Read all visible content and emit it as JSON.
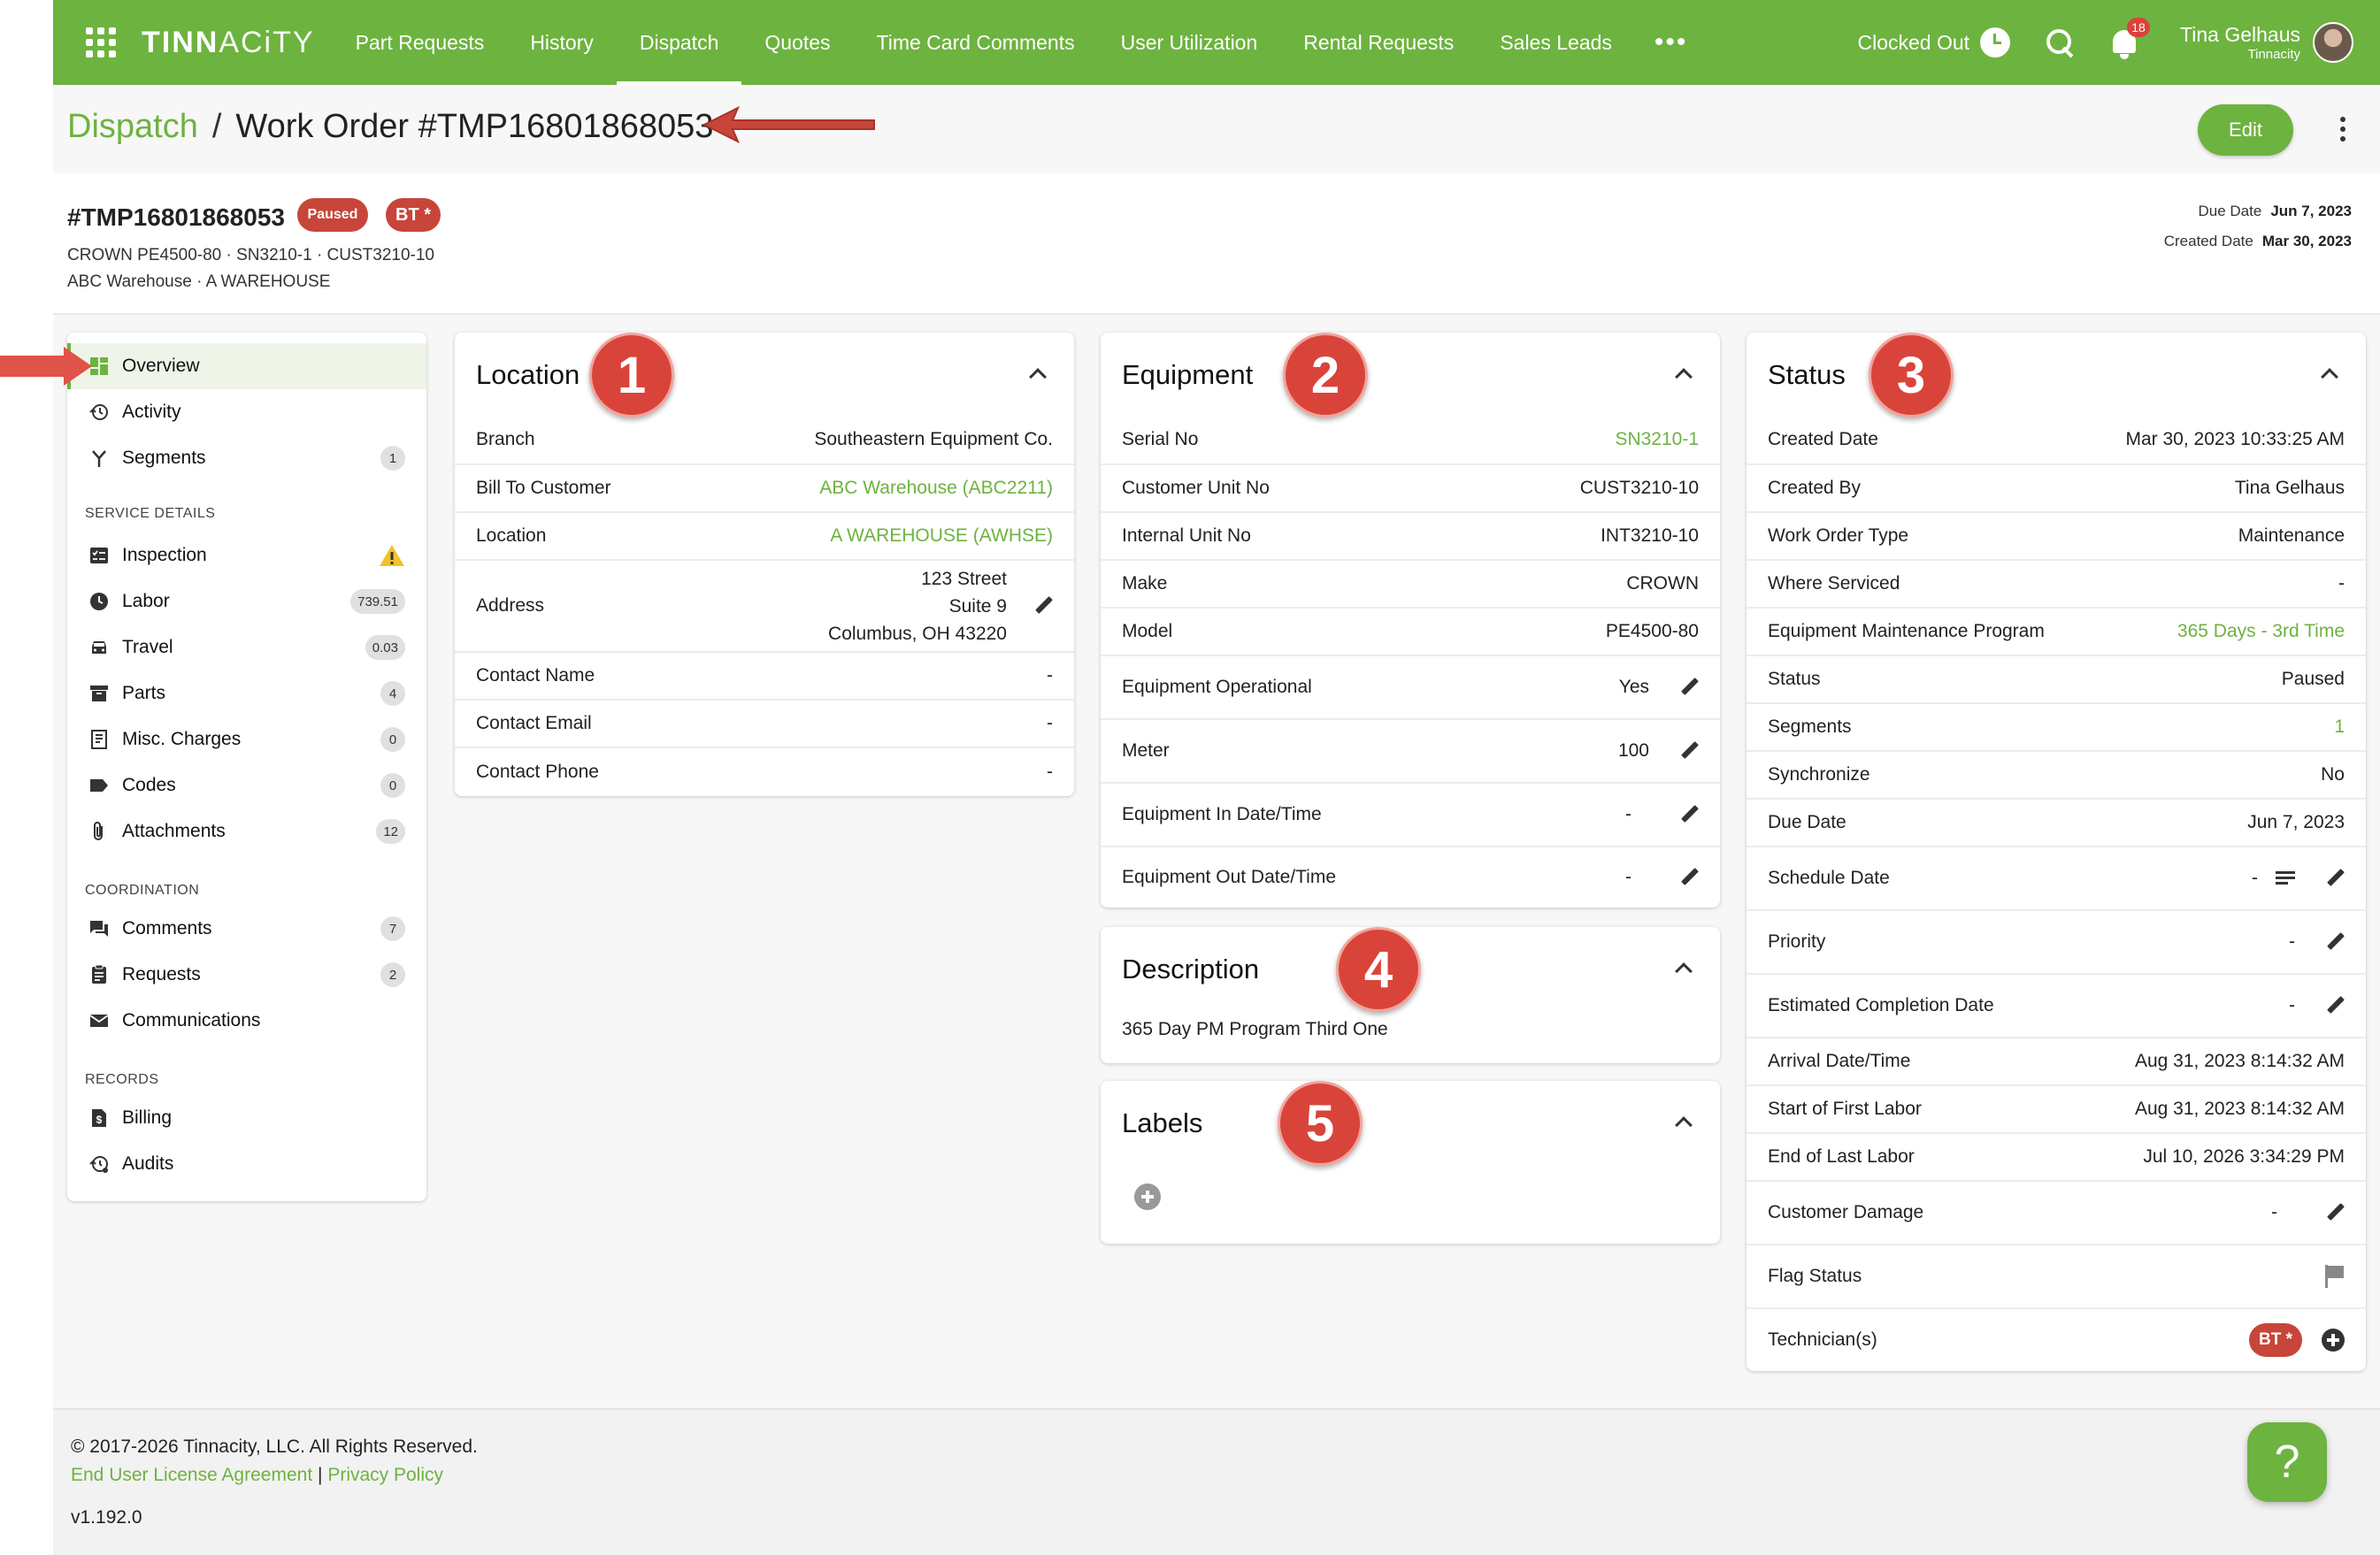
{
  "topbar": {
    "logo": {
      "bold": "TINN",
      "thin": "ACiTY"
    },
    "nav": [
      {
        "label": "Part Requests"
      },
      {
        "label": "History"
      },
      {
        "label": "Dispatch",
        "active": true
      },
      {
        "label": "Quotes"
      },
      {
        "label": "Time Card Comments"
      },
      {
        "label": "User Utilization"
      },
      {
        "label": "Rental Requests"
      },
      {
        "label": "Sales Leads"
      }
    ],
    "more": "•••",
    "clock_status": "Clocked Out",
    "notifications": "18",
    "user_name": "Tina Gelhaus",
    "user_org": "Tinnacity"
  },
  "breadcrumb": {
    "root": "Dispatch",
    "sep": "/",
    "current": "Work Order #TMP16801868053"
  },
  "edit_label": "Edit",
  "header": {
    "wo_number": "#TMP16801868053",
    "status_pill": "Paused",
    "tech_pill": "BT *",
    "line1": "CROWN PE4500-80 · SN3210-1 · CUST3210-10",
    "line2": "ABC Warehouse · A WAREHOUSE",
    "due_label": "Due Date",
    "due_value": "Jun 7, 2023",
    "created_label": "Created Date",
    "created_value": "Mar 30, 2023"
  },
  "menu": {
    "items": [
      {
        "label": "Overview",
        "badge": ""
      },
      {
        "label": "Activity",
        "badge": ""
      },
      {
        "label": "Segments",
        "badge": "1"
      },
      {
        "label": "Inspection",
        "badge": ""
      },
      {
        "label": "Labor",
        "badge": "739.51"
      },
      {
        "label": "Travel",
        "badge": "0.03"
      },
      {
        "label": "Parts",
        "badge": "4"
      },
      {
        "label": "Misc. Charges",
        "badge": "0"
      },
      {
        "label": "Codes",
        "badge": "0"
      },
      {
        "label": "Attachments",
        "badge": "12"
      },
      {
        "label": "Comments",
        "badge": "7"
      },
      {
        "label": "Requests",
        "badge": "2"
      },
      {
        "label": "Communications",
        "badge": ""
      },
      {
        "label": "Billing",
        "badge": ""
      },
      {
        "label": "Audits",
        "badge": ""
      }
    ],
    "sections": [
      "SERVICE DETAILS",
      "COORDINATION",
      "RECORDS"
    ]
  },
  "location": {
    "title": "Location",
    "badge": "1",
    "rows": [
      {
        "k": "Branch",
        "v": "Southeastern Equipment Co."
      },
      {
        "k": "Bill To Customer",
        "v": "ABC Warehouse  (ABC2211)"
      },
      {
        "k": "Location",
        "v": "A WAREHOUSE  (AWHSE)"
      },
      {
        "k": "Address",
        "v1": "123 Street",
        "v2": "Suite 9",
        "v3": "Columbus, OH 43220"
      },
      {
        "k": "Contact Name",
        "v": "-"
      },
      {
        "k": "Contact Email",
        "v": "-"
      },
      {
        "k": "Contact Phone",
        "v": "-"
      }
    ]
  },
  "equipment": {
    "title": "Equipment",
    "badge": "2",
    "rows": [
      {
        "k": "Serial No",
        "v": "SN3210-1"
      },
      {
        "k": "Customer Unit No",
        "v": "CUST3210-10"
      },
      {
        "k": "Internal Unit No",
        "v": "INT3210-10"
      },
      {
        "k": "Make",
        "v": "CROWN"
      },
      {
        "k": "Model",
        "v": "PE4500-80"
      },
      {
        "k": "Equipment Operational",
        "v": "Yes"
      },
      {
        "k": "Meter",
        "v": "100"
      },
      {
        "k": "Equipment In Date/Time",
        "v": "-"
      },
      {
        "k": "Equipment Out Date/Time",
        "v": "-"
      }
    ]
  },
  "description": {
    "title": "Description",
    "badge": "4",
    "text": "365 Day PM Program Third One"
  },
  "labels": {
    "title": "Labels",
    "badge": "5"
  },
  "status": {
    "title": "Status",
    "badge": "3",
    "rows": [
      {
        "k": "Created Date",
        "v": "Mar 30, 2023 10:33:25 AM"
      },
      {
        "k": "Created By",
        "v": "Tina Gelhaus"
      },
      {
        "k": "Work Order Type",
        "v": "Maintenance"
      },
      {
        "k": "Where Serviced",
        "v": "-"
      },
      {
        "k": "Equipment Maintenance Program",
        "v": "365 Days - 3rd Time"
      },
      {
        "k": "Status",
        "v": "Paused"
      },
      {
        "k": "Segments",
        "v": "1"
      },
      {
        "k": "Synchronize",
        "v": "No"
      },
      {
        "k": "Due Date",
        "v": "Jun 7, 2023"
      },
      {
        "k": "Schedule Date",
        "v": "-"
      },
      {
        "k": "Priority",
        "v": "-"
      },
      {
        "k": "Estimated Completion Date",
        "v": "-"
      },
      {
        "k": "Arrival Date/Time",
        "v": "Aug 31, 2023 8:14:32 AM"
      },
      {
        "k": "Start of First Labor",
        "v": "Aug 31, 2023 8:14:32 AM"
      },
      {
        "k": "End of Last Labor",
        "v": "Jul 10, 2026 3:34:29 PM"
      },
      {
        "k": "Customer Damage",
        "v": "-"
      },
      {
        "k": "Flag Status",
        "v": ""
      },
      {
        "k": "Technician(s)",
        "v": "BT *"
      }
    ]
  },
  "footer": {
    "copyright": "© 2017-2026 Tinnacity, LLC. All Rights Reserved.",
    "eula": "End User License Agreement",
    "divider": "|",
    "privacy": "Privacy Policy",
    "version": "v1.192.0",
    "help": "?"
  },
  "colors": {
    "brand_green": "#6db33f",
    "status_red": "#c8453a",
    "annotation_red": "#d9443a"
  }
}
